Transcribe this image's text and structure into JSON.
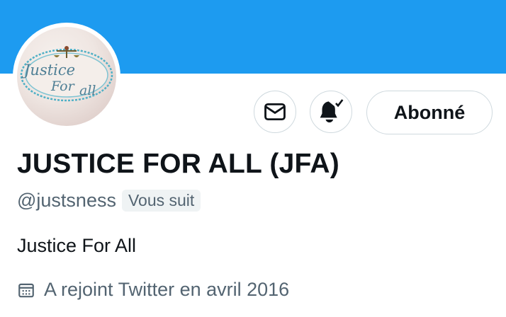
{
  "profile": {
    "display_name": "JUSTICE FOR ALL (JFA)",
    "handle": "@justsness",
    "follows_you_badge": "Vous suit",
    "bio": "Justice For All",
    "joined": "A rejoint Twitter en avril 2016"
  },
  "avatar": {
    "logo_text_line1": "Justice",
    "logo_text_line2": "For",
    "logo_text_line3": "all"
  },
  "actions": {
    "message_icon": "envelope-icon",
    "notifications_icon": "bell-check-icon",
    "follow_label": "Abonné"
  },
  "colors": {
    "banner": "#1d9bf0",
    "text_primary": "#0f1419",
    "text_secondary": "#536471",
    "border": "#cfd9de",
    "badge_bg": "#eff3f4"
  }
}
